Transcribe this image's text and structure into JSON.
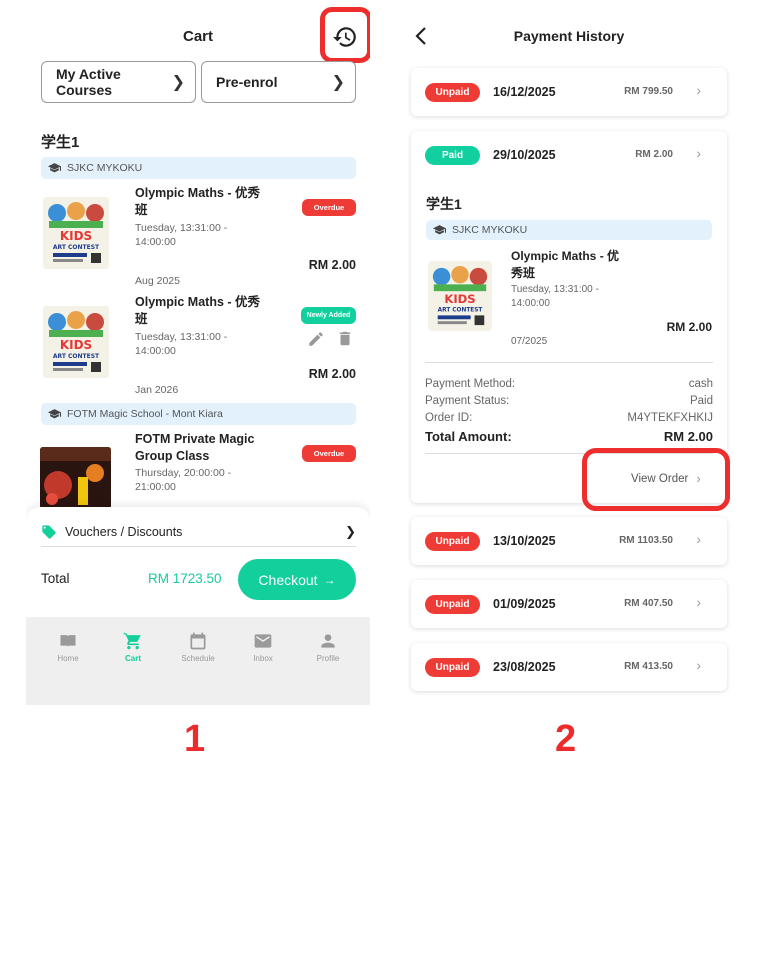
{
  "cart_screen": {
    "title": "Cart",
    "history_icon": "history-icon",
    "buttons": {
      "my_active_courses": "My Active Courses",
      "pre_enrol": "Pre-enrol"
    },
    "student_name": "学生1",
    "schools": [
      {
        "name": "SJKC MYKOKU",
        "courses": [
          {
            "title": "Olympic Maths - 优秀班",
            "title_line1": "Olympic Maths - 优秀",
            "title_line2": "班",
            "time_line1": "Tuesday, 13:31:00 -",
            "time_line2": "14:00:00",
            "month": "Aug 2025",
            "price": "RM 2.00",
            "badge": "Overdue",
            "poster_text": [
              "KIDS",
              "ART CONTEST"
            ]
          },
          {
            "title": "Olympic Maths - 优秀班",
            "title_line1": "Olympic Maths - 优秀",
            "title_line2": "班",
            "time_line1": "Tuesday, 13:31:00 -",
            "time_line2": "14:00:00",
            "month": "Jan 2026",
            "price": "RM 2.00",
            "badge": "Newly Added",
            "edit_icon": "edit-icon",
            "delete_icon": "trash-icon",
            "poster_text": [
              "KIDS",
              "ART CONTEST"
            ]
          }
        ]
      },
      {
        "name": "FOTM Magic School - Mont Kiara",
        "courses": [
          {
            "title_line1": "FOTM Private Magic",
            "title_line2": "Group Class",
            "time_line1": "Thursday, 20:00:00 -",
            "time_line2": "21:00:00",
            "badge": "Overdue"
          }
        ]
      }
    ],
    "vouchers_label": "Vouchers / Discounts",
    "total_label": "Total",
    "total_value": "RM 1723.50",
    "checkout_label": "Checkout",
    "tabs": [
      {
        "label": "Home",
        "icon": "book-icon"
      },
      {
        "label": "Cart",
        "icon": "cart-icon",
        "active": true
      },
      {
        "label": "Schedule",
        "icon": "calendar-icon"
      },
      {
        "label": "Inbox",
        "icon": "mail-icon"
      },
      {
        "label": "Profile",
        "icon": "person-icon"
      }
    ],
    "step_number": "1"
  },
  "history_screen": {
    "title": "Payment History",
    "payments": [
      {
        "status": "Unpaid",
        "date": "16/12/2025",
        "amount": "RM 799.50"
      },
      {
        "status": "Paid",
        "date": "29/10/2025",
        "amount": "RM 2.00",
        "expanded": true,
        "student": "学生1",
        "school": "SJKC MYKOKU",
        "course_title_line1": "Olympic Maths - 优",
        "course_title_line2": "秀班",
        "time_line1": "Tuesday, 13:31:00 -",
        "time_line2": "14:00:00",
        "course_price": "RM 2.00",
        "month": "07/2025",
        "details": {
          "payment_method_label": "Payment Method:",
          "payment_method": "cash",
          "payment_status_label": "Payment Status:",
          "payment_status": "Paid",
          "order_id_label": "Order ID:",
          "order_id": "M4YTEKFXHKIJ",
          "total_label": "Total Amount:",
          "total": "RM 2.00"
        },
        "view_order_label": "View Order"
      },
      {
        "status": "Unpaid",
        "date": "13/10/2025",
        "amount": "RM 1103.50"
      },
      {
        "status": "Unpaid",
        "date": "01/09/2025",
        "amount": "RM 407.50"
      },
      {
        "status": "Unpaid",
        "date": "23/08/2025",
        "amount": "RM 413.50"
      }
    ],
    "step_number": "2"
  },
  "colors": {
    "accent_green": "#13cf9c",
    "unpaid_red": "#ef3b36",
    "highlight_red": "#ee2d2d",
    "school_bar": "#e2f1fc"
  }
}
